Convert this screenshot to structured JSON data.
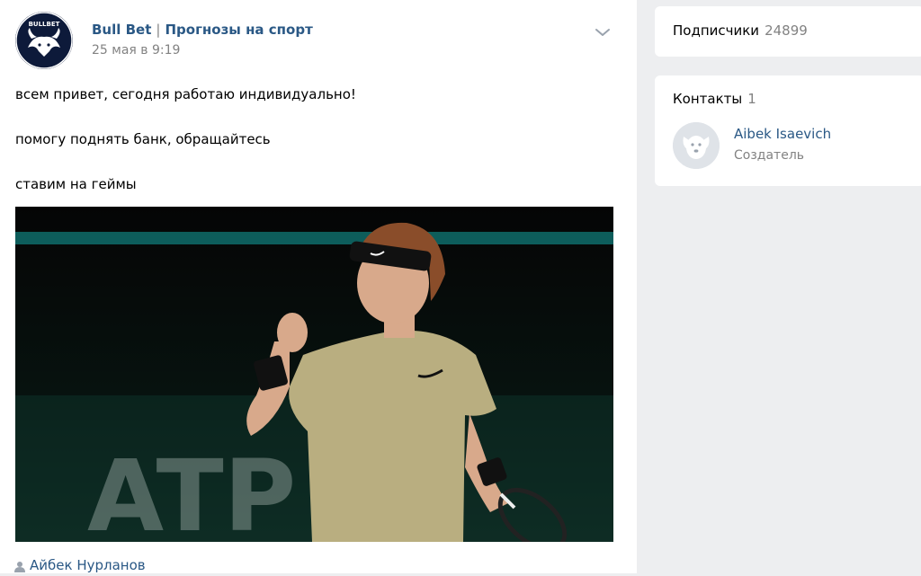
{
  "post": {
    "author": "Bull Bet",
    "separator": "|",
    "author_subtitle": "Прогнозы на спорт",
    "date": "25 мая в 9:19",
    "text_lines": [
      "всем привет, сегодня работаю индивидуально!",
      "помогу поднять банк, обращайтесь",
      "ставим на геймы"
    ],
    "avatar_logo_text": "BULLBET",
    "photo_logo_text": "ATP",
    "signer": "Айбек Нурланов"
  },
  "sidebar": {
    "subscribers": {
      "label": "Подписчики",
      "count": "24899"
    },
    "contacts": {
      "label": "Контакты",
      "count": "1",
      "items": [
        {
          "name": "Aibek Isaevich",
          "role": "Создатель"
        }
      ]
    }
  },
  "colors": {
    "page_bg": "#edeef0",
    "link": "#2a5885",
    "muted": "#828282",
    "photo_teal": "#0f6c6a"
  }
}
